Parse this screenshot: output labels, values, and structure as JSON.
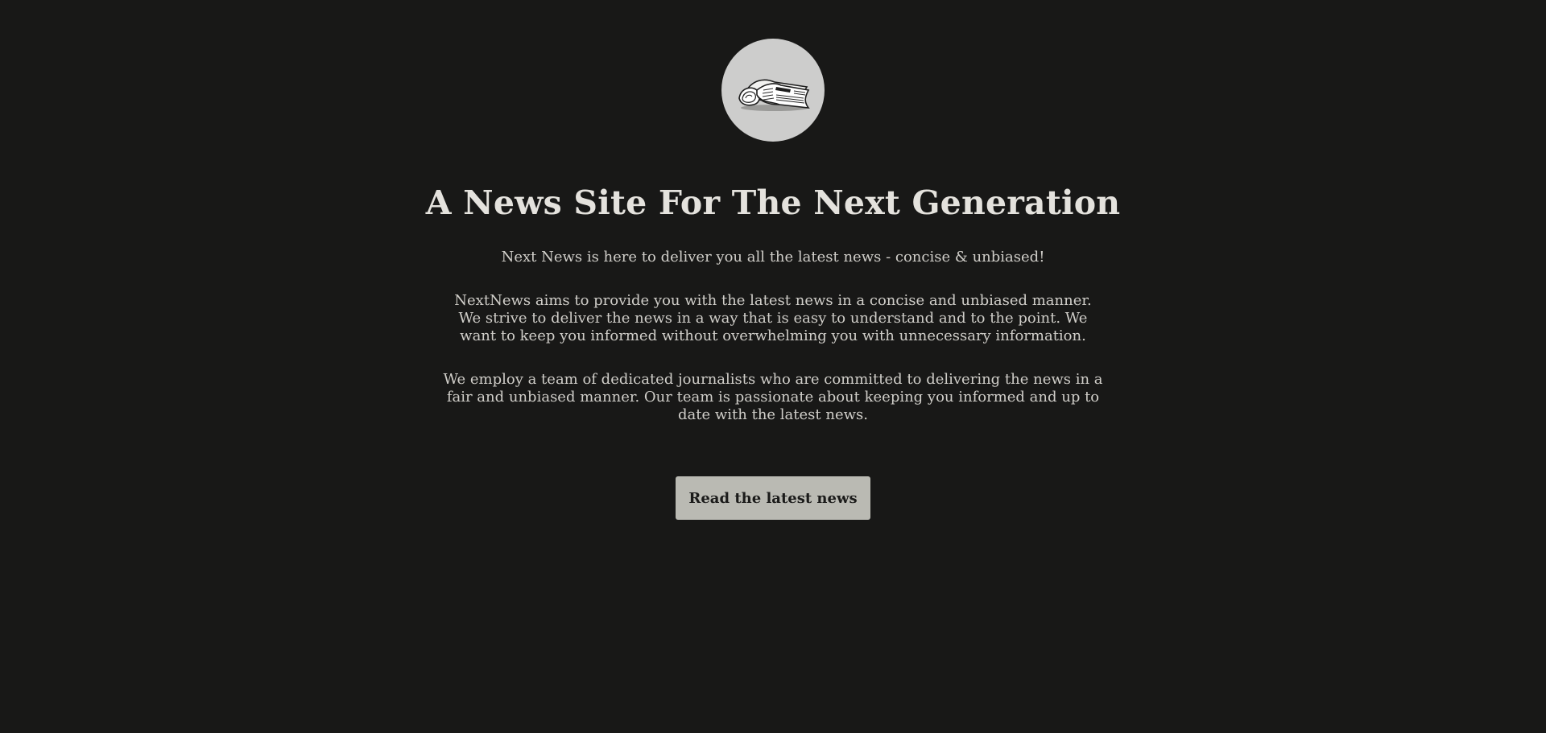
{
  "logo": {
    "icon": "newspaper-icon"
  },
  "hero": {
    "title": "A News Site For The Next Generation",
    "tagline": "Next News is here to deliver you all the latest news - concise & unbiased!",
    "paragraphs": [
      "NextNews aims to provide you with the latest news in a concise and unbiased manner. We strive to deliver the news in a way that is easy to understand and to the point. We want to keep you informed without overwhelming you with unnecessary information.",
      "We employ a team of dedicated journalists who are committed to delivering the news in a fair and unbiased manner. Our team is passionate about keeping you informed and up to date with the latest news."
    ],
    "cta_label": "Read the latest news"
  },
  "colors": {
    "background": "#181817",
    "text": "#d0cec9",
    "heading": "#e4e2dd",
    "logo_bg": "#cdcdcc",
    "button_bg": "#babab3",
    "button_text": "#1b1b1a"
  }
}
